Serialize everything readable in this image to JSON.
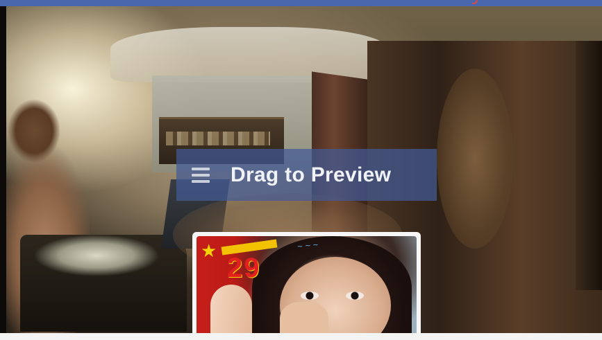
{
  "overlay": {
    "drag_label": "Drag to Preview",
    "drag_icon": "drag-handle-icon"
  },
  "preview_thumbnail": {
    "caption_number": "29",
    "flag_icon": "star-icon"
  },
  "colors": {
    "top_bar": "#4a67ad",
    "overlay_background": "#425a96",
    "overlay_text": "#f0f2f7",
    "thumbnail_frame": "#f7f7f7"
  }
}
